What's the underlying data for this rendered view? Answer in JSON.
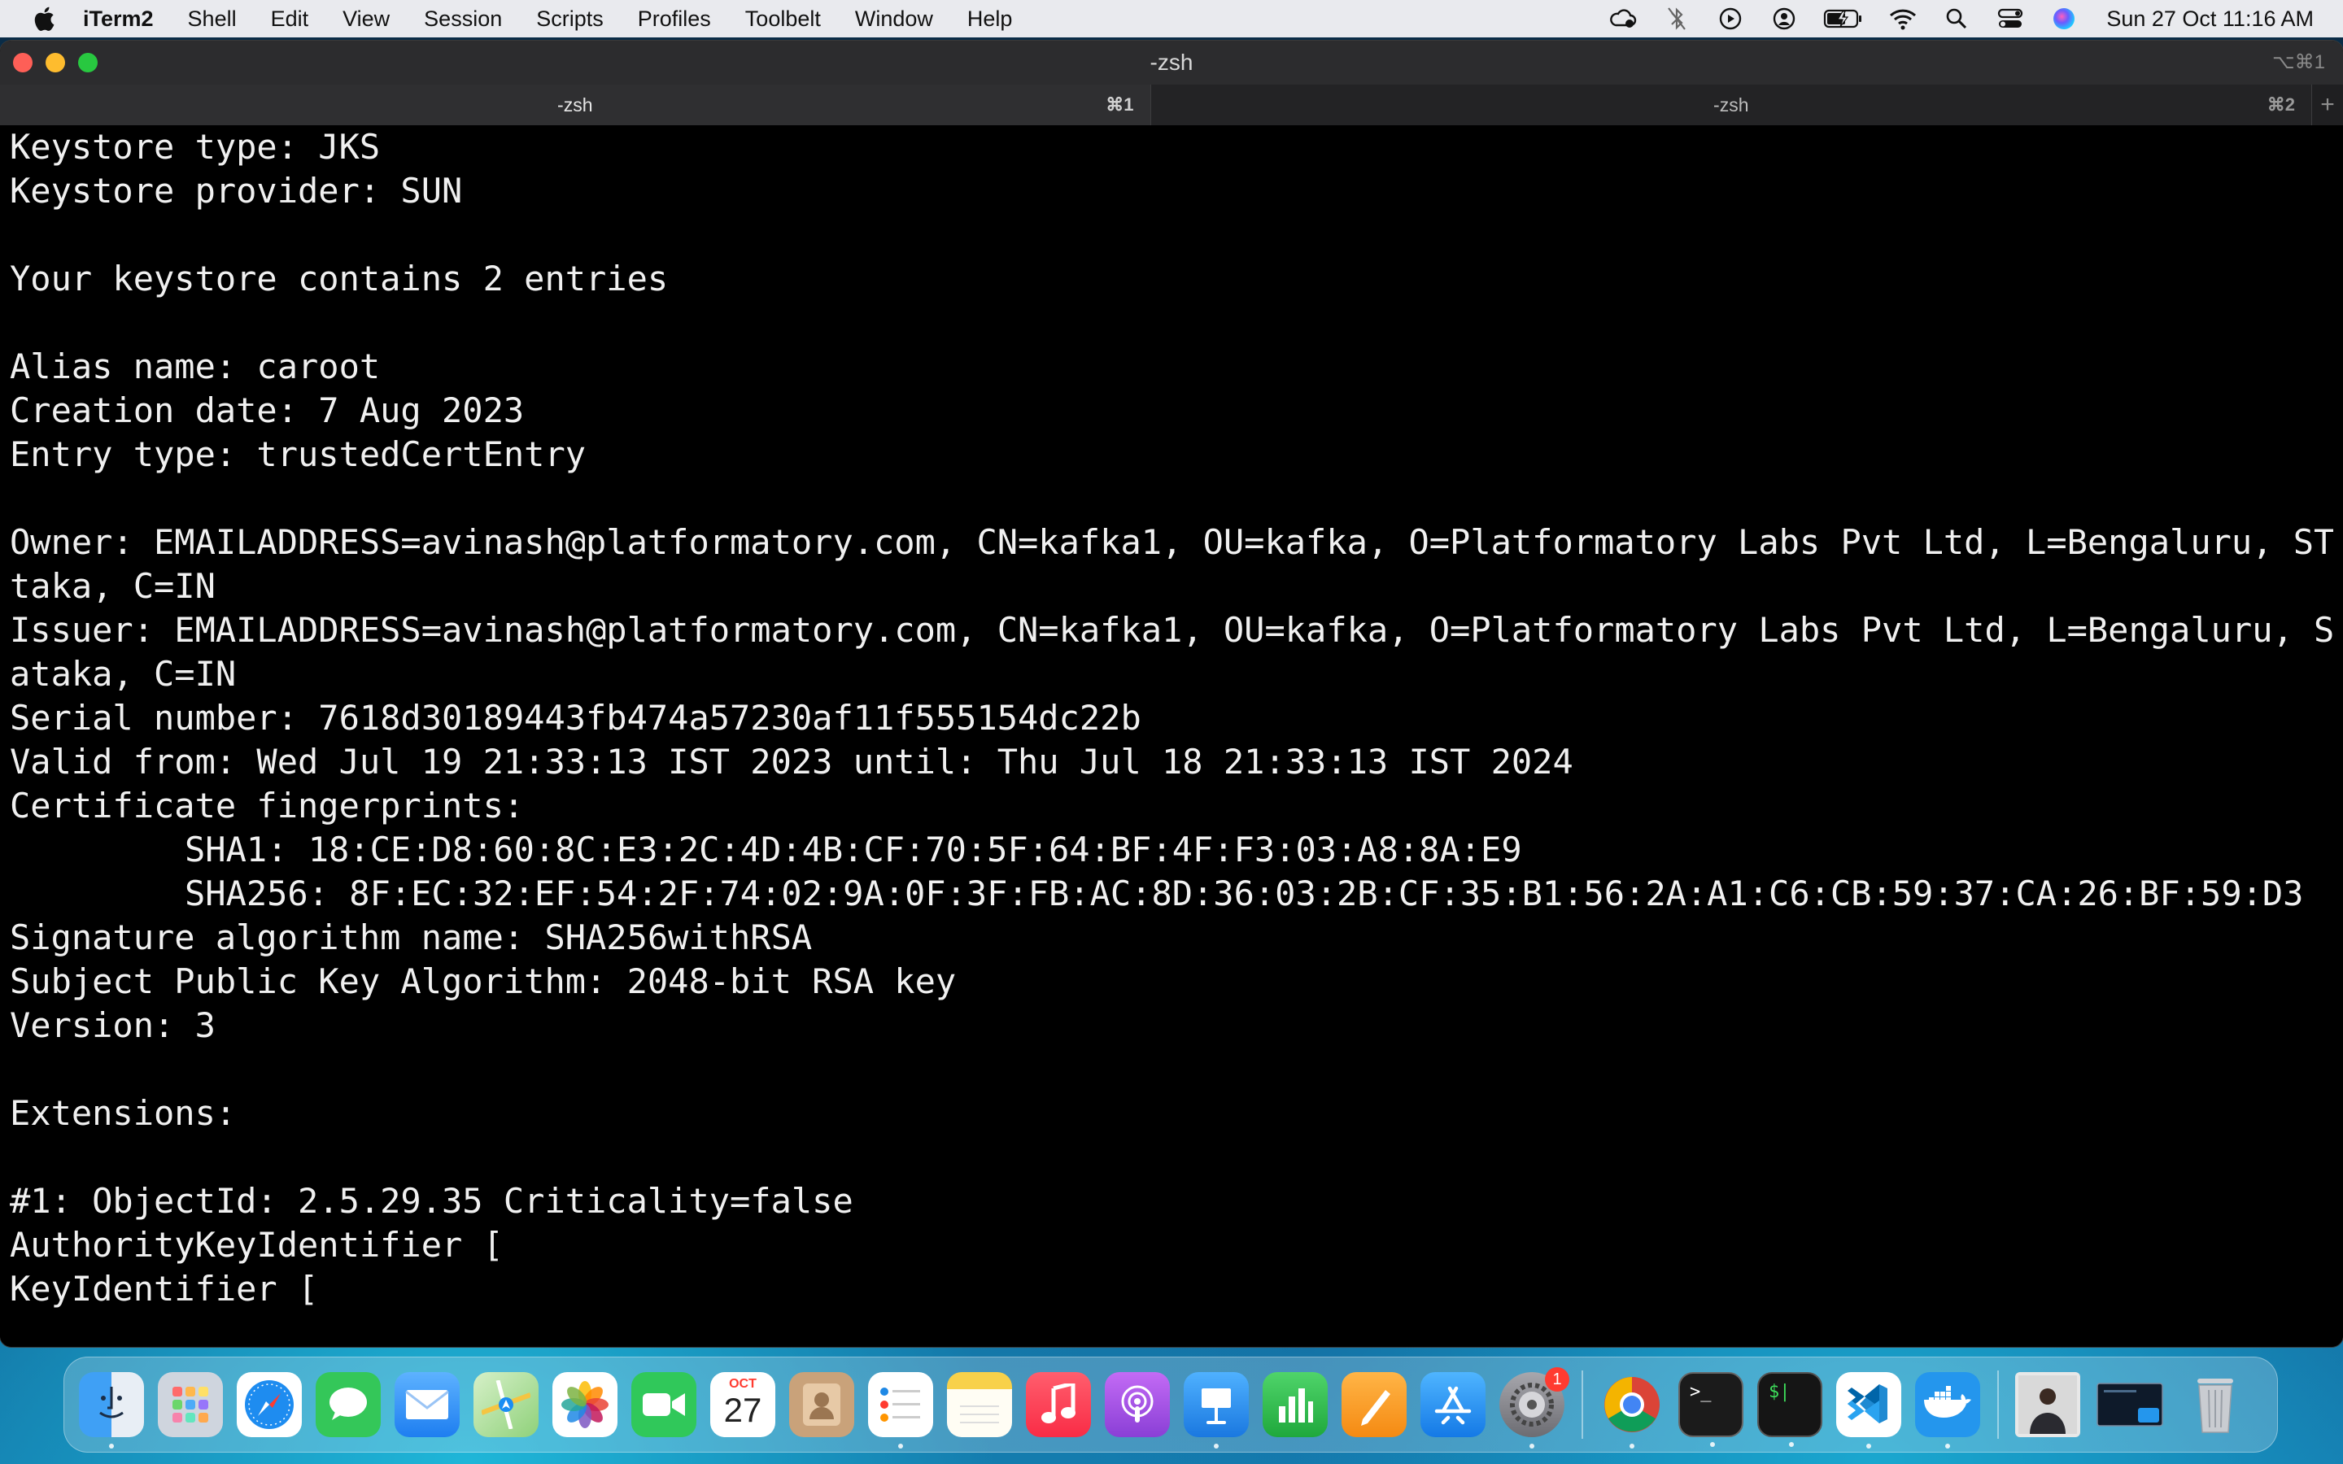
{
  "menubar": {
    "app_name": "iTerm2",
    "items": [
      "Shell",
      "Edit",
      "View",
      "Session",
      "Scripts",
      "Profiles",
      "Toolbelt",
      "Window",
      "Help"
    ],
    "clock": "Sun 27 Oct  11:16 AM",
    "status_icons": [
      "cloud-sync-icon",
      "bluetooth-off-icon",
      "play-circle-icon",
      "user-circle-icon",
      "battery-charging-icon",
      "wifi-icon",
      "search-icon",
      "control-center-icon",
      "siri-icon"
    ]
  },
  "window": {
    "title": "-zsh",
    "shortcut": "⌥⌘1",
    "tabs": [
      {
        "label": "-zsh",
        "shortcut": "⌘1",
        "active": true
      },
      {
        "label": "-zsh",
        "shortcut": "⌘2",
        "active": false
      }
    ],
    "new_tab_label": "+"
  },
  "terminal": {
    "lines": [
      "Keystore type: JKS",
      "Keystore provider: SUN",
      "",
      "Your keystore contains 2 entries",
      "",
      "Alias name: caroot",
      "Creation date: 7 Aug 2023",
      "Entry type: trustedCertEntry",
      "",
      "Owner: EMAILADDRESS=avinash@platformatory.com, CN=kafka1, OU=kafka, O=Platformatory Labs Pvt Ltd, L=Bengaluru, ST=Karna",
      "taka, C=IN",
      "Issuer: EMAILADDRESS=avinash@platformatory.com, CN=kafka1, OU=kafka, O=Platformatory Labs Pvt Ltd, L=Bengaluru, ST=Karn",
      "ataka, C=IN",
      "Serial number: 7618d30189443fb474a57230af11f555154dc22b",
      "Valid from: Wed Jul 19 21:33:13 IST 2023 until: Thu Jul 18 21:33:13 IST 2024",
      "Certificate fingerprints:",
      "SHA1: 18:CE:D8:60:8C:E3:2C:4D:4B:CF:70:5F:64:BF:4F:F3:03:A8:8A:E9",
      "SHA256: 8F:EC:32:EF:54:2F:74:02:9A:0F:3F:FB:AC:8D:36:03:2B:CF:35:B1:56:2A:A1:C6:CB:59:37:CA:26:BF:59:D3",
      "Signature algorithm name: SHA256withRSA",
      "Subject Public Key Algorithm: 2048-bit RSA key",
      "Version: 3",
      "",
      "Extensions:",
      "",
      "#1: ObjectId: 2.5.29.35 Criticality=false",
      "AuthorityKeyIdentifier [",
      "KeyIdentifier ["
    ]
  },
  "dock": {
    "apps": [
      {
        "name": "finder-icon",
        "color": "#3fa0f5"
      },
      {
        "name": "launchpad-icon",
        "color": "#9aa3b2"
      },
      {
        "name": "safari-icon",
        "color": "#1e8cf0"
      },
      {
        "name": "messages-icon",
        "color": "#34c759"
      },
      {
        "name": "mail-icon",
        "color": "#2f86f0"
      },
      {
        "name": "maps-icon",
        "color": "#6cc36a"
      },
      {
        "name": "photos-icon",
        "color": "#ffffff"
      },
      {
        "name": "facetime-icon",
        "color": "#30c85a"
      },
      {
        "name": "calendar-icon",
        "color": "#ffffff",
        "month": "OCT",
        "day": "27"
      },
      {
        "name": "contacts-icon",
        "color": "#b58c62"
      },
      {
        "name": "reminders-icon",
        "color": "#ffffff"
      },
      {
        "name": "notes-icon",
        "color": "#f8d14a"
      },
      {
        "name": "music-icon",
        "color": "#fb3a4f"
      },
      {
        "name": "podcasts-icon",
        "color": "#9c4de0"
      },
      {
        "name": "keynote-icon",
        "color": "#2a8ee8"
      },
      {
        "name": "numbers-icon",
        "color": "#2fbf4f"
      },
      {
        "name": "pages-icon",
        "color": "#f99b28"
      },
      {
        "name": "app-store-icon",
        "color": "#1a8df3"
      },
      {
        "name": "system-settings-icon",
        "color": "#8e8e93",
        "badge": "1"
      },
      {
        "name": "chrome-icon",
        "color": "#ffffff"
      },
      {
        "name": "terminal-icon",
        "color": "#1b1b1b",
        "glyph": ">_"
      },
      {
        "name": "iterm-icon",
        "color": "#151515",
        "glyph": "$|"
      },
      {
        "name": "vscode-icon",
        "color": "#ffffff"
      },
      {
        "name": "docker-icon",
        "color": "#2496ed"
      },
      {
        "name": "downloads-stack-icon",
        "color": "#d9d9d9"
      },
      {
        "name": "screenshot-stack-icon",
        "color": "#1c3a5a"
      },
      {
        "name": "trash-icon",
        "color": "#c9ccd1"
      }
    ]
  }
}
